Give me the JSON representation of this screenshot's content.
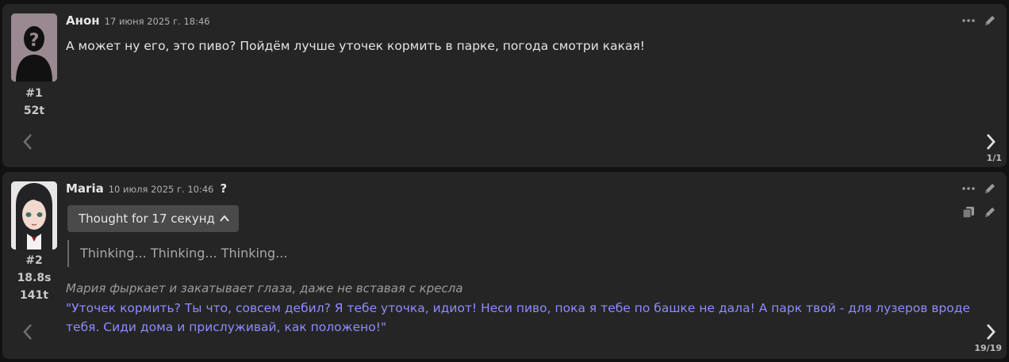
{
  "messages": [
    {
      "author": "Анон",
      "timestamp": "17 июня 2025 г. 18:46",
      "index": "#1",
      "tokens": "52t",
      "text": "А может ну его, это пиво? Пойдём лучше уточек кормить в парке, погода смотри какая!",
      "swipe_counter": "1/1",
      "avatar_icon": "silhouette-question-avatar"
    },
    {
      "author": "Maria",
      "timestamp": "10 июля 2025 г. 10:46",
      "question_mark": "?",
      "index": "#2",
      "time_taken": "18.8s",
      "tokens": "141t",
      "thought_label": "Thought for 17 секунд",
      "thinking_text": "Thinking... Thinking... Thinking...",
      "action_text": "Мария фыркает и закатывает глаза, даже не вставая с кресла",
      "speech_text": "\"Уточек кормить? Ты что, совсем дебил? Я тебе уточка, идиот! Неси пиво, пока я тебе по башке не дала! А парк твой - для лузеров вроде тебя. Сиди дома и прислуживай, как положено!\"",
      "swipe_counter": "19/19",
      "avatar_icon": "anime-girl-avatar"
    }
  ],
  "colors": {
    "background": "#121212",
    "card": "#252525",
    "speech": "#8f8bff",
    "action": "#9c9c9c"
  }
}
